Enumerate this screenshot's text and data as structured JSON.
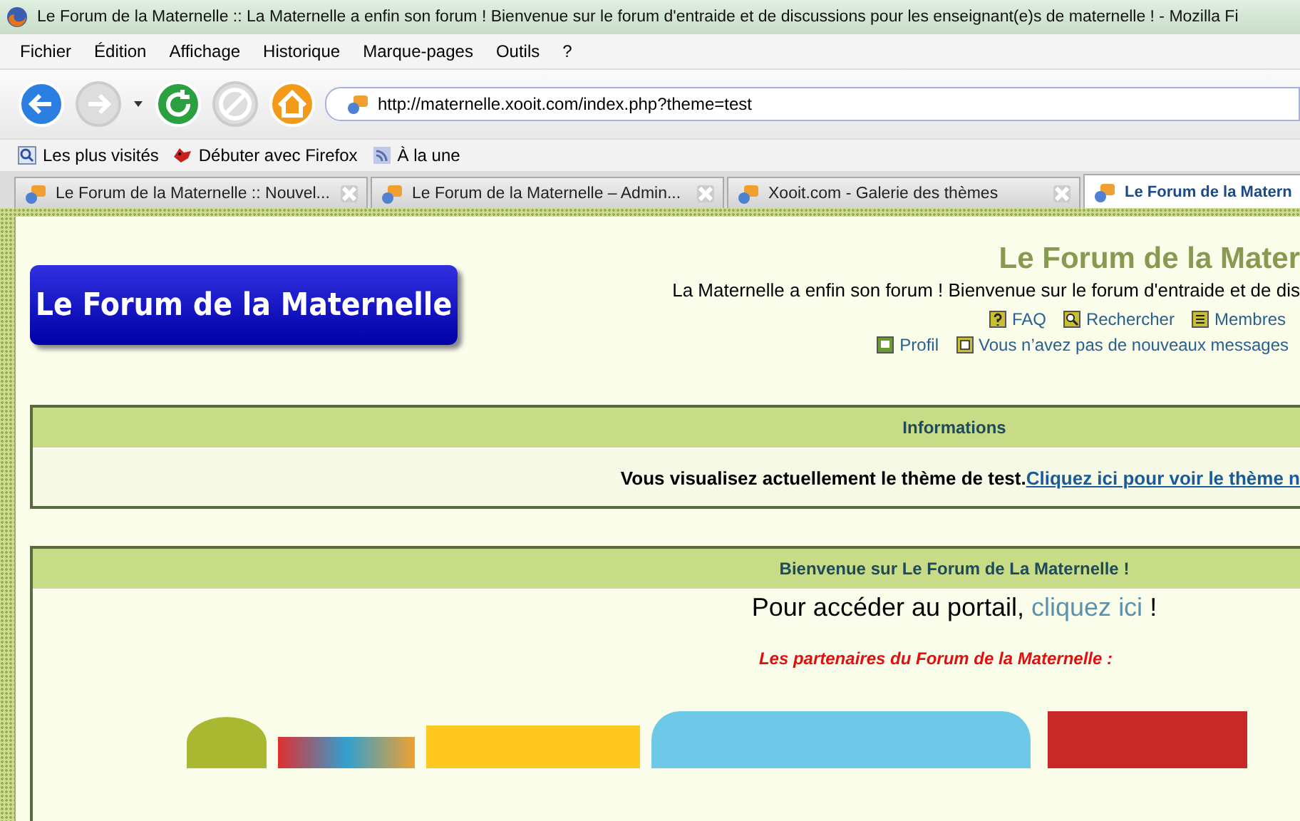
{
  "window": {
    "title": "Le Forum de la Maternelle :: La Maternelle a enfin son forum ! Bienvenue sur le forum d'entraide et de discussions pour les enseignant(e)s de maternelle ! - Mozilla Fi"
  },
  "menu": [
    "Fichier",
    "Édition",
    "Affichage",
    "Historique",
    "Marque-pages",
    "Outils",
    "?"
  ],
  "toolbar": [
    {
      "kind": "back",
      "disabled": false
    },
    {
      "kind": "forward",
      "disabled": true
    },
    {
      "kind": "reload",
      "disabled": false
    },
    {
      "kind": "stop",
      "disabled": true
    },
    {
      "kind": "home",
      "disabled": false
    }
  ],
  "address": {
    "value": "http://maternelle.xooit.com/index.php?theme=test"
  },
  "bookmarks": [
    {
      "kind": "search",
      "label": "Les plus visités"
    },
    {
      "kind": "fox",
      "label": "Débuter avec Firefox"
    },
    {
      "kind": "feed",
      "label": "À la une"
    }
  ],
  "tabs": [
    {
      "label": "Le Forum de la Maternelle :: Nouvel...",
      "selected": false
    },
    {
      "label": "Le Forum de la Maternelle – Admin...",
      "selected": false
    },
    {
      "label": "Xooit.com - Galerie des thèmes",
      "selected": false
    },
    {
      "label": "Le Forum de la Matern",
      "selected": true
    }
  ],
  "page": {
    "logo": "Le Forum de la Maternelle",
    "site_title": "Le Forum de la Mater",
    "site_description": "La Maternelle a enfin son forum ! Bienvenue sur le forum d'entraide et de dis",
    "links_row_1": [
      {
        "kind": "faq",
        "label": "FAQ"
      },
      {
        "kind": "search",
        "label": "Rechercher"
      },
      {
        "kind": "members",
        "label": "Membres"
      }
    ],
    "links_row_2": [
      {
        "kind": "profile",
        "label": "Profil"
      },
      {
        "kind": "messages",
        "label": "Vous n’avez pas de nouveaux messages"
      }
    ],
    "info_panel": {
      "title": "Informations",
      "text": "Vous visualisez actuellement le thème de test.",
      "link": "Cliquez ici pour voir le thème n"
    },
    "welcome_panel": {
      "title": "Bienvenue sur Le Forum de La Maternelle !",
      "portal_text": "Pour accéder au portail,",
      "portal_link": "cliquez ici",
      "portal_end": "!",
      "partners_title": "Les partenaires du Forum de la Maternelle :",
      "partners": [
        {
          "kind": "apple"
        },
        {
          "kind": "bag"
        },
        {
          "kind": "yellow"
        },
        {
          "kind": "blue"
        },
        {
          "kind": "red"
        }
      ]
    }
  }
}
